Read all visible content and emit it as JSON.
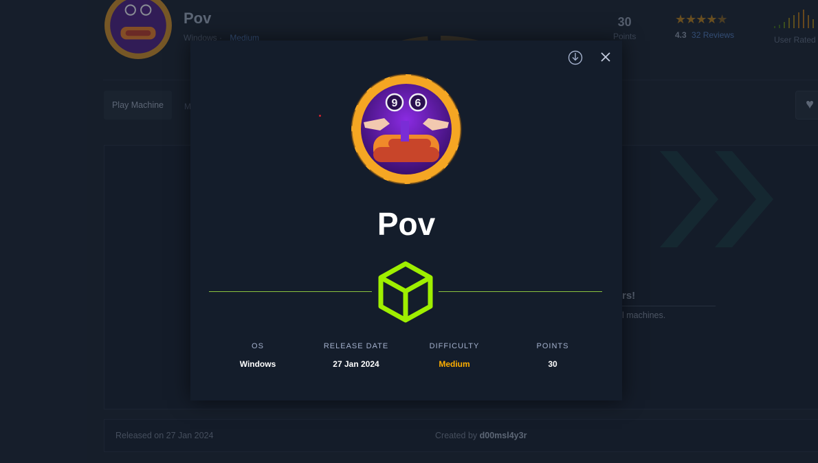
{
  "header": {
    "title": "Pov",
    "os": "Windows",
    "separator": "·",
    "difficulty": "Medium",
    "points_value": "30",
    "points_label": "Points",
    "rating_value": "4.3",
    "reviews": "32 Reviews",
    "rating_stars": 4.5,
    "user_rated_label": "User Rated"
  },
  "tabs": {
    "play_machine": "Play Machine",
    "next_tab_initial": "M"
  },
  "side_panel": {
    "heading": "rs!",
    "text": "l machines."
  },
  "footer": {
    "released": "Released on 27 Jan 2024",
    "created_by_label": "Created by",
    "creator": "d00msl4y3r"
  },
  "modal": {
    "title": "Pov",
    "info": [
      {
        "label": "OS",
        "value": "Windows"
      },
      {
        "label": "RELEASE DATE",
        "value": "27 Jan 2024"
      },
      {
        "label": "DIFFICULTY",
        "value": "Medium"
      },
      {
        "label": "POINTS",
        "value": "30"
      }
    ],
    "avatar_digits": [
      "9",
      "6"
    ]
  },
  "icons": {
    "download": "download-icon",
    "close": "close-icon",
    "cube": "cube-icon",
    "heart": "heart-icon"
  },
  "colors": {
    "accent_green": "#9fef00",
    "difficulty_medium": "#ffaf00",
    "avatar_ring": "#f5a623",
    "avatar_inner": "#5a1a9e"
  }
}
